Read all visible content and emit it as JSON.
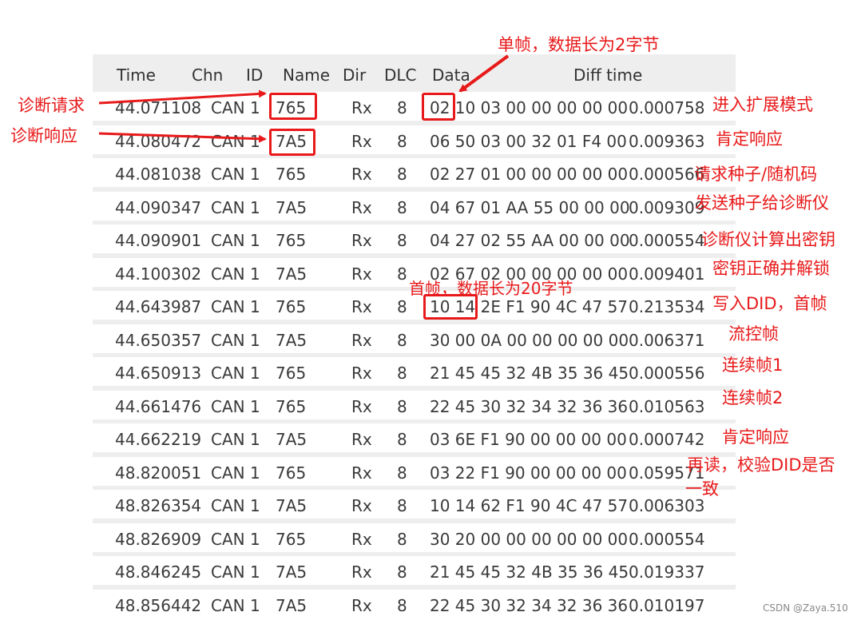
{
  "columns": {
    "time": "Time",
    "chn": "Chn",
    "id": "ID",
    "name": "Name",
    "dir": "Dir",
    "dlc": "DLC",
    "data": "Data",
    "diff": "Diff time"
  },
  "rows": [
    {
      "time": "44.071108",
      "chn": "CAN 1",
      "name": "765",
      "dir": "Rx",
      "dlc": "8",
      "data": "02 10 03 00 00 00 00 00",
      "diff": "0.000758"
    },
    {
      "time": "44.080472",
      "chn": "CAN 1",
      "name": "7A5",
      "dir": "Rx",
      "dlc": "8",
      "data": "06 50 03 00 32 01 F4 00",
      "diff": "0.009363"
    },
    {
      "time": "44.081038",
      "chn": "CAN 1",
      "name": "765",
      "dir": "Rx",
      "dlc": "8",
      "data": "02 27 01 00 00 00 00 00",
      "diff": "0.000566"
    },
    {
      "time": "44.090347",
      "chn": "CAN 1",
      "name": "7A5",
      "dir": "Rx",
      "dlc": "8",
      "data": "04 67 01 AA 55 00 00 00",
      "diff": "0.009309"
    },
    {
      "time": "44.090901",
      "chn": "CAN 1",
      "name": "765",
      "dir": "Rx",
      "dlc": "8",
      "data": "04 27 02 55 AA 00 00 00",
      "diff": "0.000554"
    },
    {
      "time": "44.100302",
      "chn": "CAN 1",
      "name": "7A5",
      "dir": "Rx",
      "dlc": "8",
      "data": "02 67 02 00 00 00 00 00",
      "diff": "0.009401"
    },
    {
      "time": "44.643987",
      "chn": "CAN 1",
      "name": "765",
      "dir": "Rx",
      "dlc": "8",
      "data": "10 14 2E F1 90 4C 47 57",
      "diff": "0.213534"
    },
    {
      "time": "44.650357",
      "chn": "CAN 1",
      "name": "7A5",
      "dir": "Rx",
      "dlc": "8",
      "data": "30 00 0A 00 00 00 00 00",
      "diff": "0.006371"
    },
    {
      "time": "44.650913",
      "chn": "CAN 1",
      "name": "765",
      "dir": "Rx",
      "dlc": "8",
      "data": "21 45 45 32 4B 35 36 45",
      "diff": "0.000556"
    },
    {
      "time": "44.661476",
      "chn": "CAN 1",
      "name": "765",
      "dir": "Rx",
      "dlc": "8",
      "data": "22 45 30 32 34 32 36 36",
      "diff": "0.010563"
    },
    {
      "time": "44.662219",
      "chn": "CAN 1",
      "name": "7A5",
      "dir": "Rx",
      "dlc": "8",
      "data": "03 6E F1 90 00 00 00 00",
      "diff": "0.000742"
    },
    {
      "time": "48.820051",
      "chn": "CAN 1",
      "name": "765",
      "dir": "Rx",
      "dlc": "8",
      "data": "03 22 F1 90 00 00 00 00",
      "diff": "0.059571"
    },
    {
      "time": "48.826354",
      "chn": "CAN 1",
      "name": "7A5",
      "dir": "Rx",
      "dlc": "8",
      "data": "10 14 62 F1 90 4C 47 57",
      "diff": "0.006303"
    },
    {
      "time": "48.826909",
      "chn": "CAN 1",
      "name": "765",
      "dir": "Rx",
      "dlc": "8",
      "data": "30 20 00 00 00 00 00 00",
      "diff": "0.000554"
    },
    {
      "time": "48.846245",
      "chn": "CAN 1",
      "name": "7A5",
      "dir": "Rx",
      "dlc": "8",
      "data": "21 45 45 32 4B 35 36 45",
      "diff": "0.019337"
    },
    {
      "time": "48.856442",
      "chn": "CAN 1",
      "name": "7A5",
      "dir": "Rx",
      "dlc": "8",
      "data": "22 45 30 32 34 32 36 36",
      "diff": "0.010197"
    }
  ],
  "annotations": {
    "single_frame": "单帧，数据长为2字节",
    "first_frame": "首帧，数据长为20字节",
    "diag_request": "诊断请求",
    "diag_response": "诊断响应",
    "right": [
      "进入扩展模式",
      "肯定响应",
      "请求种子/随机码",
      "发送种子给诊断仪",
      "诊断仪计算出密钥",
      "密钥正确并解锁",
      "写入DID，首帧",
      "流控帧",
      "连续帧1",
      "连续帧2",
      "肯定响应",
      "再读，校验DID是否",
      "一致"
    ]
  },
  "watermark": "CSDN @Zaya.510",
  "colors": {
    "annotation": "#e8191a",
    "table_bg": "#eeeeee",
    "row_bg": "#ffffff",
    "text": "#3a3a3a"
  }
}
